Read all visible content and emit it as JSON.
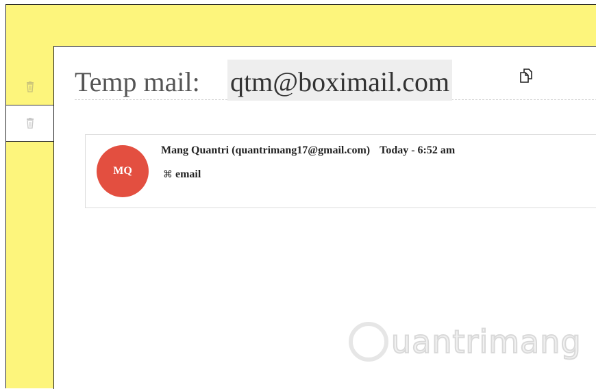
{
  "header": {
    "temp_label": "Temp mail:",
    "temp_email": "qtm@boximail.com"
  },
  "sidebar": {
    "items": [
      {
        "icon": "trash-icon"
      },
      {
        "icon": "trash-icon"
      }
    ]
  },
  "inbox": {
    "messages": [
      {
        "avatar": "MQ",
        "from": "Mang Quantri (quantrimang17@gmail.com)",
        "date": "Today - 6:52 am",
        "subject_symbol": "⌘",
        "subject": "email"
      }
    ]
  },
  "watermark": {
    "brand": "uantrimang"
  },
  "colors": {
    "background": "#fdf57c",
    "avatar": "#e34f40",
    "email_highlight": "#eeeeee"
  }
}
